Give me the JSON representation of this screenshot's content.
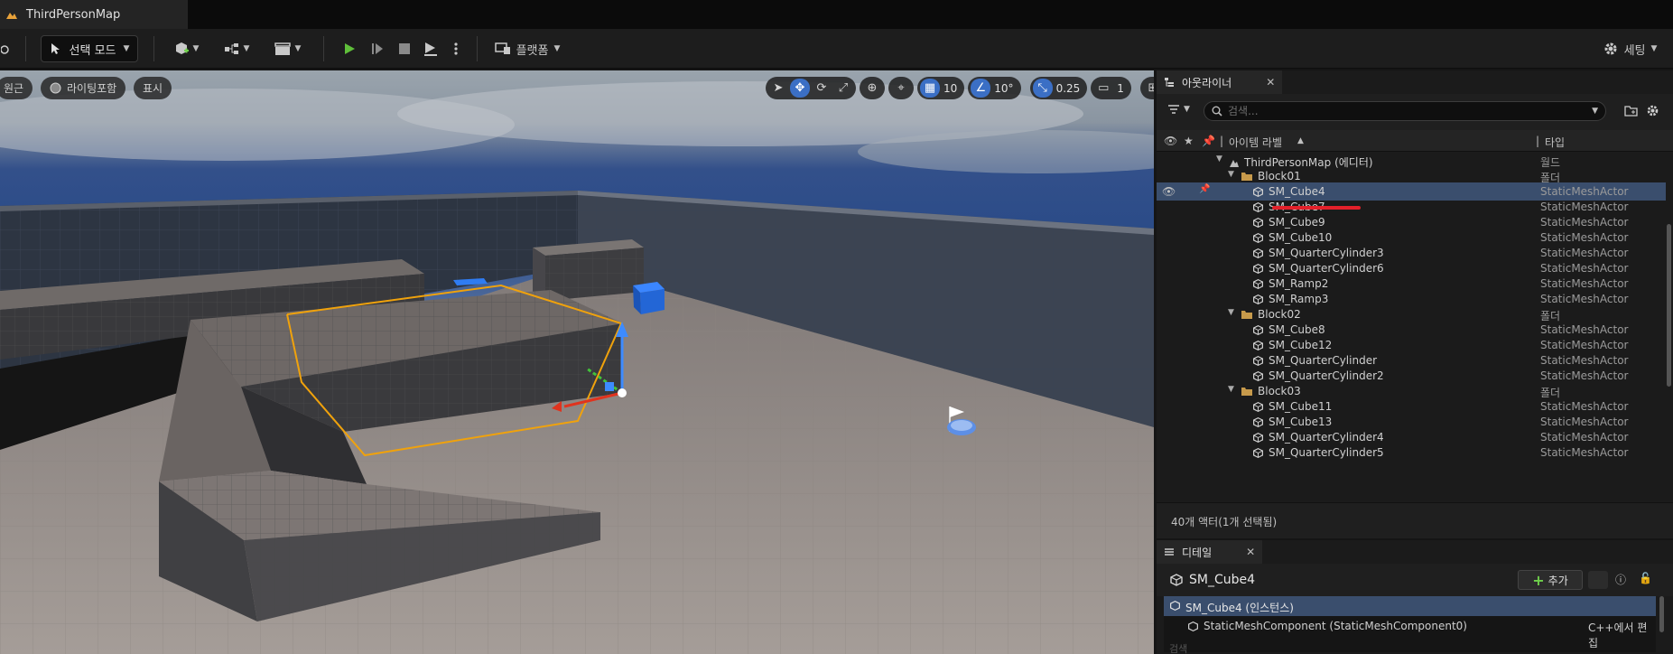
{
  "window": {
    "tab_title": "ThirdPersonMap"
  },
  "toolbar": {
    "mode_label": "선택 모드",
    "platforms_label": "플랫폼",
    "settings_label": "세팅"
  },
  "viewport": {
    "view_label": "원근",
    "lit_label": "라이팅포함",
    "show_label": "표시",
    "grid_snap": "10",
    "rotation_snap": "10°",
    "scale_snap": "0.25",
    "camera_speed": "1"
  },
  "outliner": {
    "tab_title": "아웃라이너",
    "search_placeholder": "검색...",
    "col_label": "아이템 라벨",
    "col_type": "타입",
    "rows": [
      {
        "name": "ThirdPersonMap (에디터)",
        "type": "월드"
      },
      {
        "name": "Block01",
        "type": "폴더"
      },
      {
        "name": "SM_Cube4",
        "type": "StaticMeshActor"
      },
      {
        "name": "SM_Cube7",
        "type": "StaticMeshActor"
      },
      {
        "name": "SM_Cube9",
        "type": "StaticMeshActor"
      },
      {
        "name": "SM_Cube10",
        "type": "StaticMeshActor"
      },
      {
        "name": "SM_QuarterCylinder3",
        "type": "StaticMeshActor"
      },
      {
        "name": "SM_QuarterCylinder6",
        "type": "StaticMeshActor"
      },
      {
        "name": "SM_Ramp2",
        "type": "StaticMeshActor"
      },
      {
        "name": "SM_Ramp3",
        "type": "StaticMeshActor"
      },
      {
        "name": "Block02",
        "type": "폴더"
      },
      {
        "name": "SM_Cube8",
        "type": "StaticMeshActor"
      },
      {
        "name": "SM_Cube12",
        "type": "StaticMeshActor"
      },
      {
        "name": "SM_QuarterCylinder",
        "type": "StaticMeshActor"
      },
      {
        "name": "SM_QuarterCylinder2",
        "type": "StaticMeshActor"
      },
      {
        "name": "Block03",
        "type": "폴더"
      },
      {
        "name": "SM_Cube11",
        "type": "StaticMeshActor"
      },
      {
        "name": "SM_Cube13",
        "type": "StaticMeshActor"
      },
      {
        "name": "SM_QuarterCylinder4",
        "type": "StaticMeshActor"
      },
      {
        "name": "SM_QuarterCylinder5",
        "type": "StaticMeshActor"
      }
    ],
    "footer": "40개 액터(1개 선택됨)"
  },
  "details": {
    "tab_title": "디테일",
    "actor_name": "SM_Cube4",
    "add_label": "추가",
    "instance_label": "SM_Cube4 (인스턴스)",
    "component_label": "StaticMeshComponent (StaticMeshComponent0)",
    "edit_in_cpp": "C++에서 편집",
    "search_hint": "검색"
  }
}
